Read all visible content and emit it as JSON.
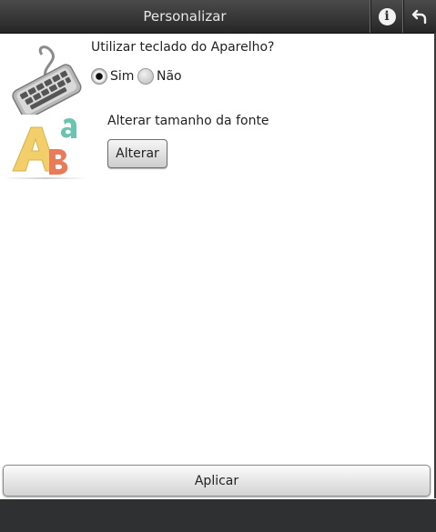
{
  "header": {
    "title": "Personalizar"
  },
  "keyboard_option": {
    "question": "Utilizar teclado do Aparelho?",
    "options": [
      {
        "label": "Sim",
        "selected": true
      },
      {
        "label": "Não",
        "selected": false
      }
    ]
  },
  "font_option": {
    "label": "Alterar tamanho da fonte",
    "button_label": "Alterar"
  },
  "footer": {
    "apply_label": "Aplicar"
  },
  "icons": [
    "info-icon",
    "back-arrow-icon",
    "keyboard-icon",
    "font-abc-icon"
  ],
  "colors": {
    "topbar": "#333333",
    "bottombar": "#2f3032",
    "background": "#ffffff"
  }
}
